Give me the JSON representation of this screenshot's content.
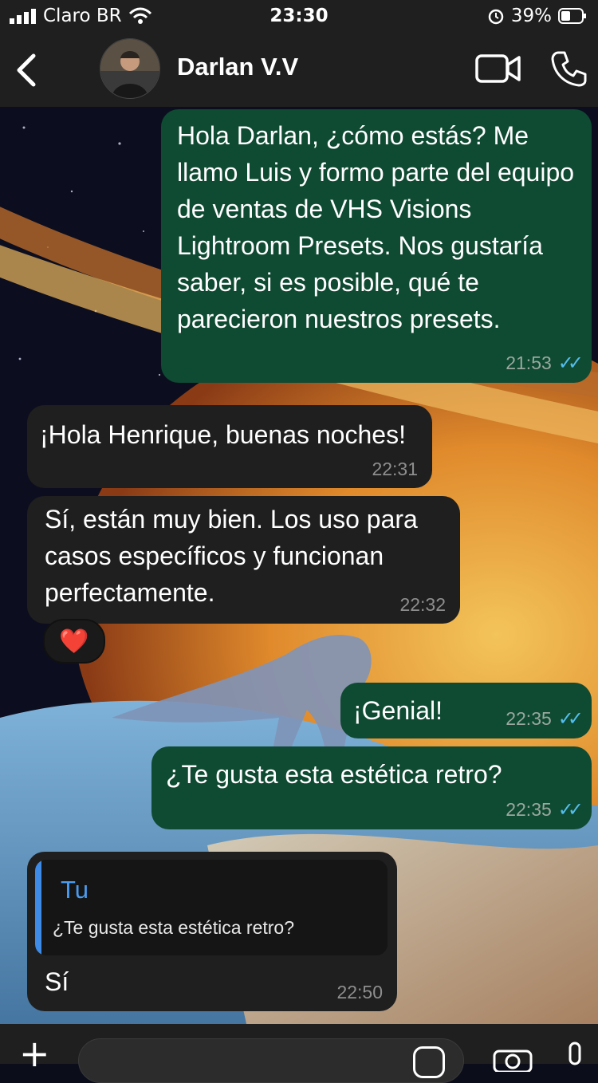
{
  "status_bar": {
    "carrier": "Claro BR",
    "time": "23:30",
    "battery": "39%"
  },
  "header": {
    "contact_name": "Darlan V.V"
  },
  "messages": [
    {
      "direction": "out",
      "text": "Hola Darlan, ¿cómo estás? Me llamo Luis y formo parte del equipo de ventas de VHS Visions Lightroom Presets. Nos gustaría saber, si es posible, qué te parecieron nuestros presets.",
      "time": "21:53"
    },
    {
      "direction": "in",
      "text": "¡Hola Henrique, buenas noches!",
      "time": "22:31"
    },
    {
      "direction": "in",
      "text": "Sí, están muy bien. Los uso para casos específicos y funcionan perfectamente.",
      "time": "22:32",
      "reaction": "❤️"
    },
    {
      "direction": "out",
      "text": "¡Genial!",
      "time": "22:35"
    },
    {
      "direction": "out",
      "text": "¿Te gusta esta estética retro?",
      "time": "22:35"
    },
    {
      "direction": "in",
      "text": "Sí",
      "time": "22:50",
      "quote": {
        "author": "Tu",
        "text": "¿Te gusta esta estética retro?"
      }
    }
  ],
  "colors": {
    "outgoing_bubble": "#0f4a32",
    "incoming_bubble": "#1f1f1f",
    "read_ticks": "#53bdeb",
    "quote_accent": "#3d8be6"
  }
}
